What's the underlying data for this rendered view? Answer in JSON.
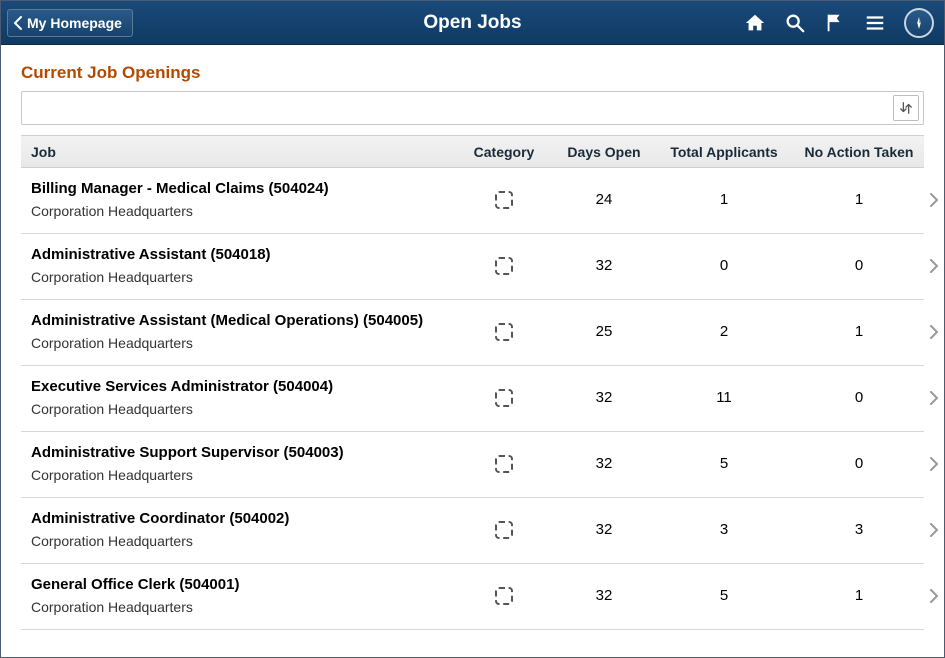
{
  "navbar": {
    "back_label": "My Homepage",
    "title": "Open Jobs"
  },
  "page": {
    "heading": "Current Job Openings"
  },
  "columns": {
    "job": "Job",
    "category": "Category",
    "days_open": "Days Open",
    "total_applicants": "Total Applicants",
    "no_action": "No Action Taken"
  },
  "rows": [
    {
      "title": "Billing Manager - Medical Claims (504024)",
      "location": "Corporation Headquarters",
      "days_open": "24",
      "applicants": "1",
      "no_action": "1"
    },
    {
      "title": "Administrative Assistant (504018)",
      "location": "Corporation Headquarters",
      "days_open": "32",
      "applicants": "0",
      "no_action": "0"
    },
    {
      "title": "Administrative Assistant (Medical Operations) (504005)",
      "location": "Corporation Headquarters",
      "days_open": "25",
      "applicants": "2",
      "no_action": "1"
    },
    {
      "title": "Executive Services Administrator (504004)",
      "location": "Corporation Headquarters",
      "days_open": "32",
      "applicants": "11",
      "no_action": "0"
    },
    {
      "title": "Administrative Support Supervisor (504003)",
      "location": "Corporation Headquarters",
      "days_open": "32",
      "applicants": "5",
      "no_action": "0"
    },
    {
      "title": "Administrative Coordinator (504002)",
      "location": "Corporation Headquarters",
      "days_open": "32",
      "applicants": "3",
      "no_action": "3"
    },
    {
      "title": "General Office Clerk (504001)",
      "location": "Corporation Headquarters",
      "days_open": "32",
      "applicants": "5",
      "no_action": "1"
    }
  ]
}
